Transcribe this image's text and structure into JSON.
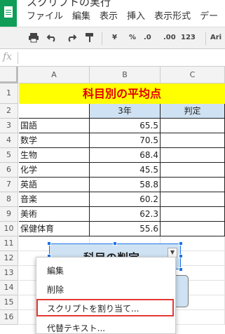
{
  "window": {
    "title": "スクリプトの実行"
  },
  "menubar": [
    "ファイル",
    "編集",
    "表示",
    "挿入",
    "表示形式",
    "デー"
  ],
  "toolbar": {
    "icons": [
      "print-icon",
      "undo-icon",
      "redo-icon",
      "paint-format-icon"
    ],
    "currency": "¥",
    "percent": "%",
    "decimal_decrease": ".0",
    "decimal_increase": ".00",
    "number_format": "123",
    "font": "Ari"
  },
  "formula_bar": {
    "fx": "fx",
    "value": ""
  },
  "columns": [
    "A",
    "B",
    "C"
  ],
  "rows": [
    "1",
    "2",
    "3",
    "4",
    "5",
    "6",
    "7",
    "8",
    "9",
    "10",
    "11",
    "12",
    "13",
    "14",
    "15",
    "16"
  ],
  "sheet": {
    "title": "科目別の平均点",
    "header_year": "3年",
    "header_grade": "判定",
    "subjects": [
      {
        "name": "国語",
        "score": "65.5"
      },
      {
        "name": "数学",
        "score": "70.5"
      },
      {
        "name": "生物",
        "score": "68.4"
      },
      {
        "name": "化学",
        "score": "45.5"
      },
      {
        "name": "英語",
        "score": "58.8"
      },
      {
        "name": "音楽",
        "score": "60.2"
      },
      {
        "name": "美術",
        "score": "62.3"
      },
      {
        "name": "保健体育",
        "score": "55.6"
      }
    ]
  },
  "drawing": {
    "label": "科目の判定"
  },
  "context_menu": {
    "edit": "編集",
    "delete": "削除",
    "assign_script": "スクリプトを割り当て...",
    "alt_text": "代替テキスト..."
  },
  "colors": {
    "title_bg": "#ffff00",
    "title_fg": "#e00000",
    "header_bg": "#cfe2f3",
    "highlight": "#e53935"
  }
}
